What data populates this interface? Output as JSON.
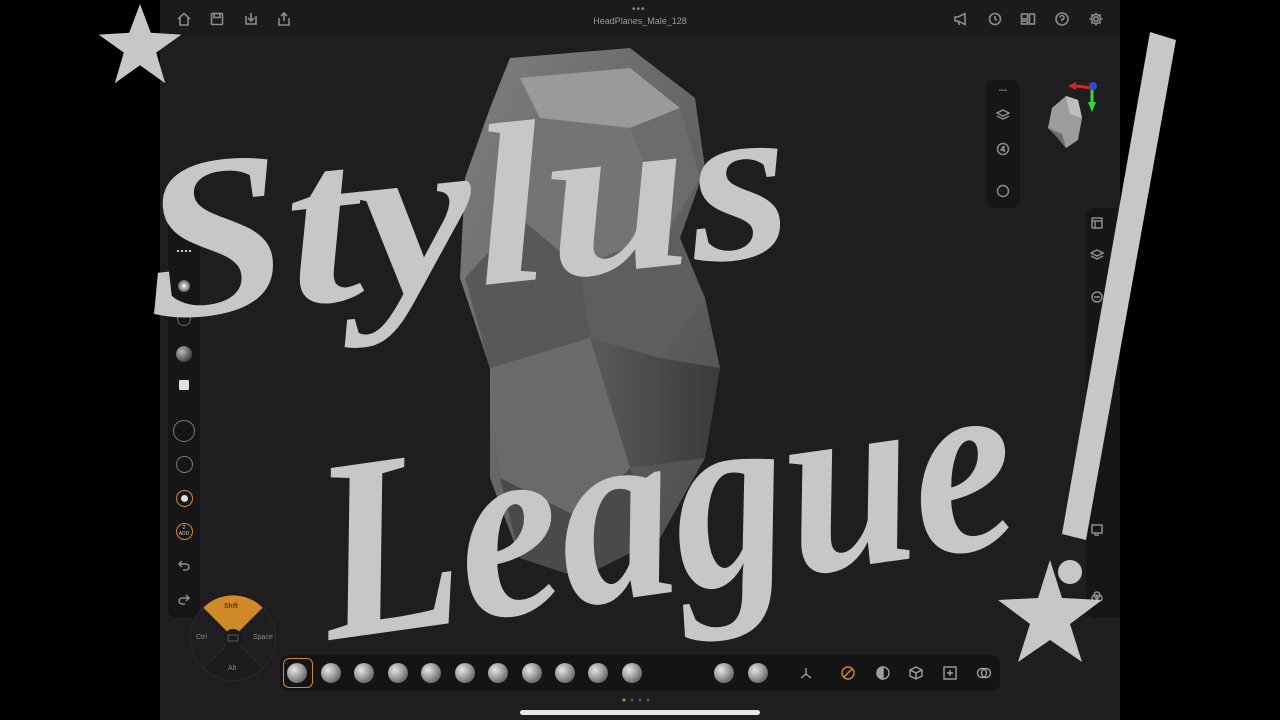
{
  "window": {
    "title": "HeadPlanes_Male_128"
  },
  "modifier_wheel": {
    "shift": "Shift",
    "ctrl": "Ctrl",
    "space": "Space",
    "alt": "Alt"
  },
  "left_toolbar": {
    "add_label": "ADD",
    "add_num": "2"
  },
  "overlay_text": {
    "line1": "Stylus",
    "line2": "League",
    "mark": "!"
  },
  "colors": {
    "accent": "#d08a2a",
    "overlay": "#c7c7c9",
    "gizmo_x": "#e0201c",
    "gizmo_y": "#3ad43a",
    "gizmo_z": "#2a4ad8"
  },
  "topbar_icons": [
    "home-icon",
    "save-icon",
    "import-icon",
    "share-icon",
    "announce-icon",
    "history-icon",
    "layout-icon",
    "help-icon",
    "settings-icon"
  ],
  "brushes_count_visible": 16
}
